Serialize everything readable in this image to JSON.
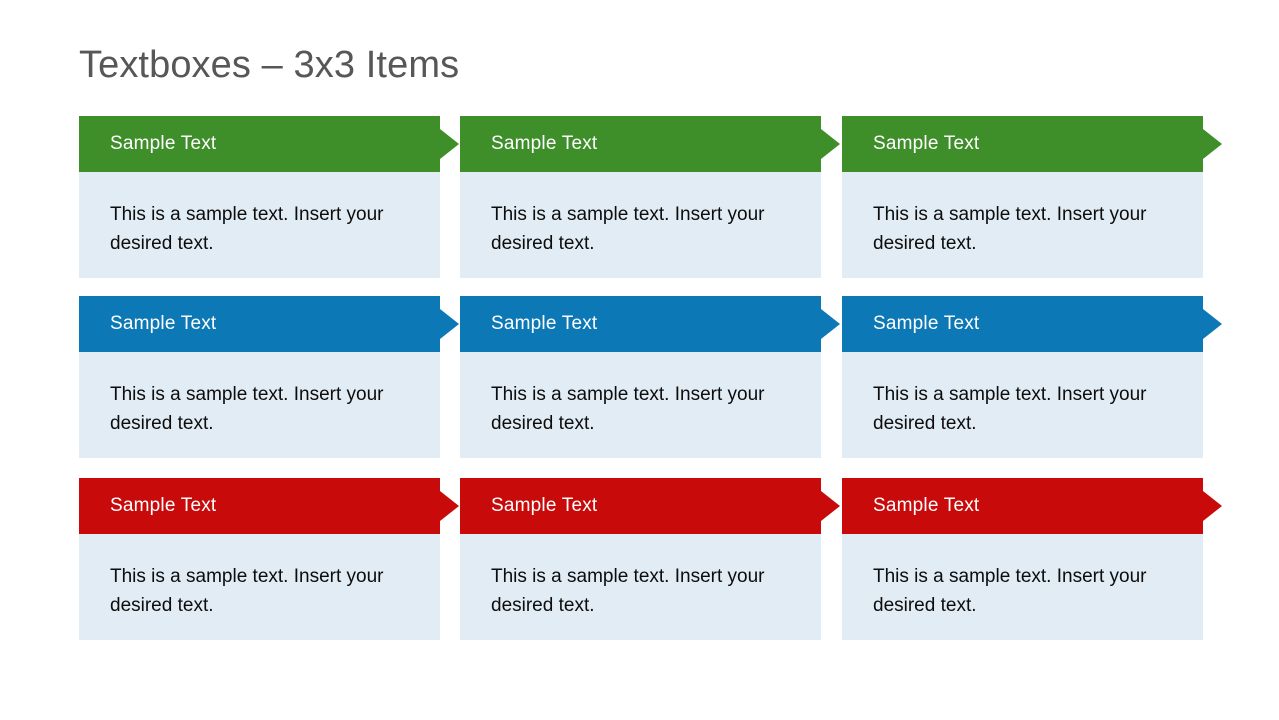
{
  "slide": {
    "title": "Textboxes – 3x3 Items",
    "title_color": "#575757",
    "background_color": "#ffffff"
  },
  "theme": {
    "body_background": "#e1ecf4",
    "body_text_color": "#0d0d0d",
    "header_text_color": "#ffffff",
    "row_colors": [
      "#3e8e29",
      "#0c78b6",
      "#c80a0a"
    ]
  },
  "cards": [
    {
      "row": 0,
      "col": 0,
      "color": "#3e8e29",
      "heading": "Sample Text",
      "body": "This is a sample text. Insert your desired text."
    },
    {
      "row": 0,
      "col": 1,
      "color": "#3e8e29",
      "heading": "Sample Text",
      "body": "This is a sample text. Insert your desired text."
    },
    {
      "row": 0,
      "col": 2,
      "color": "#3e8e29",
      "heading": "Sample Text",
      "body": "This is a sample text. Insert your desired text."
    },
    {
      "row": 1,
      "col": 0,
      "color": "#0c78b6",
      "heading": "Sample Text",
      "body": "This is a sample text. Insert your desired text."
    },
    {
      "row": 1,
      "col": 1,
      "color": "#0c78b6",
      "heading": "Sample Text",
      "body": "This is a sample text. Insert your desired text."
    },
    {
      "row": 1,
      "col": 2,
      "color": "#0c78b6",
      "heading": "Sample Text",
      "body": "This is a sample text. Insert your desired text."
    },
    {
      "row": 2,
      "col": 0,
      "color": "#c80a0a",
      "heading": "Sample Text",
      "body": "This is a sample text. Insert your desired text."
    },
    {
      "row": 2,
      "col": 1,
      "color": "#c80a0a",
      "heading": "Sample Text",
      "body": "This is a sample text. Insert your desired text."
    },
    {
      "row": 2,
      "col": 2,
      "color": "#c80a0a",
      "heading": "Sample Text",
      "body": "This is a sample text. Insert your desired text."
    }
  ]
}
